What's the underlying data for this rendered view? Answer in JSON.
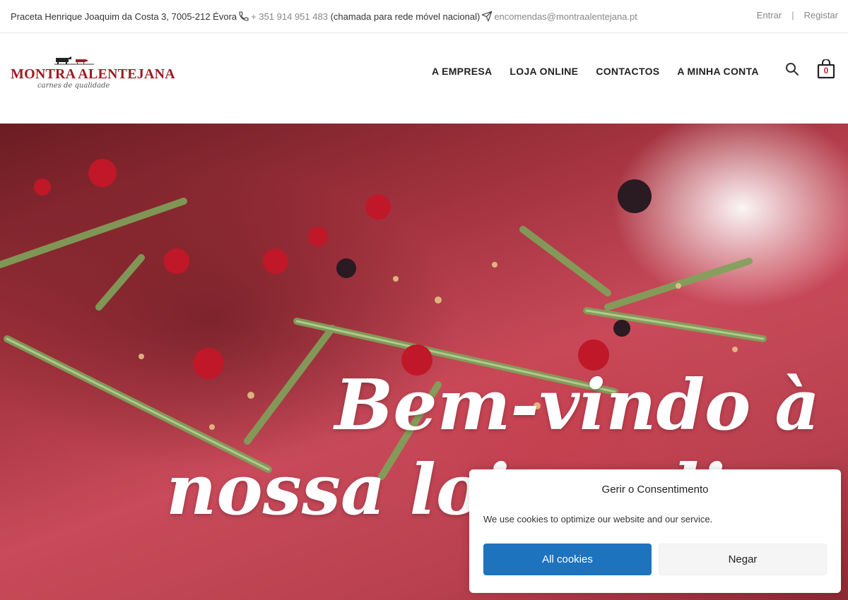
{
  "topbar": {
    "address": "Praceta Henrique Joaquim da Costa 3, 7005-212 Évora",
    "phone": "+ 351 914 951 483",
    "phone_note": "(chamada para rede móvel nacional)",
    "email": "encomendas@montraalentejana.pt",
    "login": "Entrar",
    "separator": "|",
    "register": "Registar",
    "icons": {
      "phone": "phone-icon",
      "email": "send-icon"
    }
  },
  "header": {
    "logo": {
      "brand": "MONTRA ALENTEJANA",
      "tagline": "carnes de qualidade"
    },
    "nav": [
      "A EMPRESA",
      "LOJA ONLINE",
      "CONTACTOS",
      "A MINHA CONTA"
    ],
    "cart_count": "0",
    "icons": {
      "search": "search-icon",
      "cart": "shopping-bag-icon"
    }
  },
  "hero": {
    "line1": "Bem-vindo à",
    "line2": "nossa loja online"
  },
  "consent": {
    "title": "Gerir o Consentimento",
    "message": "We use cookies to optimize our website and our service.",
    "accept": "All cookies",
    "deny": "Negar"
  },
  "colors": {
    "brand_red": "#9c1c22",
    "accept_blue": "#1e73be",
    "cart_badge": "#c6262e"
  }
}
